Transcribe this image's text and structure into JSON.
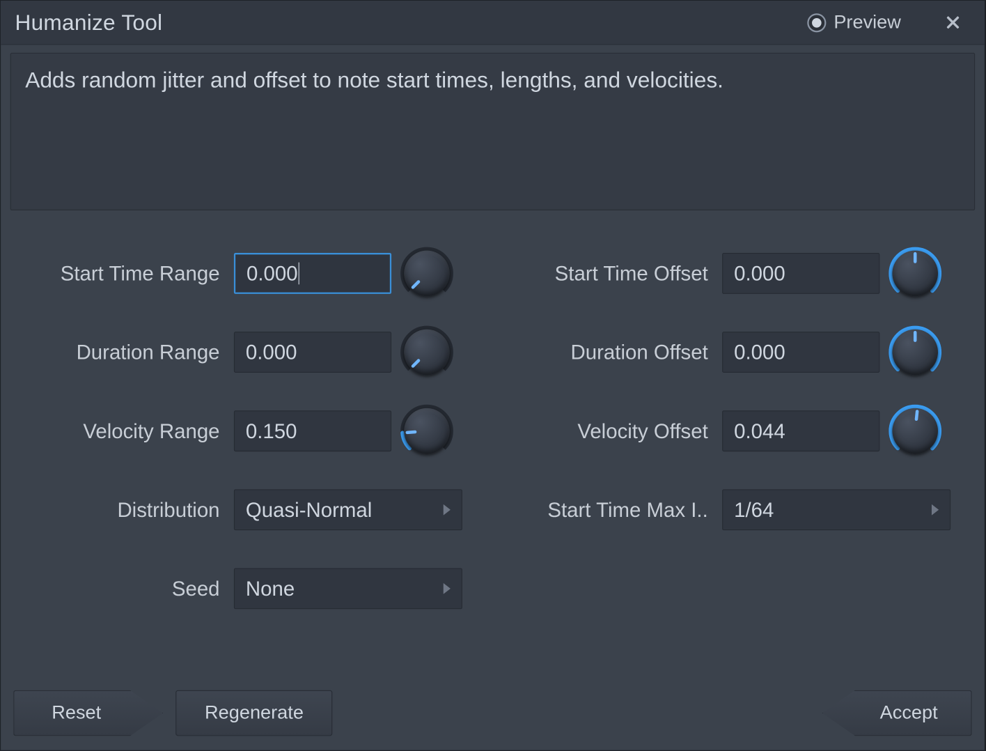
{
  "title": "Humanize Tool",
  "preview_label": "Preview",
  "preview_checked": true,
  "description": "Adds random jitter and offset to note start times, lengths, and velocities.",
  "labels": {
    "start_time_range": "Start Time Range",
    "duration_range": "Duration Range",
    "velocity_range": "Velocity Range",
    "distribution": "Distribution",
    "seed": "Seed",
    "start_time_offset": "Start Time Offset",
    "duration_offset": "Duration Offset",
    "velocity_offset": "Velocity Offset",
    "start_time_max": "Start Time Max I.."
  },
  "values": {
    "start_time_range": "0.000",
    "duration_range": "0.000",
    "velocity_range": "0.150",
    "distribution": "Quasi-Normal",
    "seed": "None",
    "start_time_offset": "0.000",
    "duration_offset": "0.000",
    "velocity_offset": "0.044",
    "start_time_max": "1/64"
  },
  "knobs": {
    "start_time_range": {
      "type": "unipolar",
      "value": 0.0
    },
    "duration_range": {
      "type": "unipolar",
      "value": 0.0
    },
    "velocity_range": {
      "type": "unipolar",
      "value": 0.15
    },
    "start_time_offset": {
      "type": "bipolar",
      "value": 0.0
    },
    "duration_offset": {
      "type": "bipolar",
      "value": 0.0
    },
    "velocity_offset": {
      "type": "bipolar",
      "value": 0.044
    }
  },
  "buttons": {
    "reset": "Reset",
    "regenerate": "Regenerate",
    "accept": "Accept"
  },
  "colors": {
    "accent": "#3b9cf0",
    "panel_bg": "#3b424c",
    "field_bg": "#303640"
  }
}
